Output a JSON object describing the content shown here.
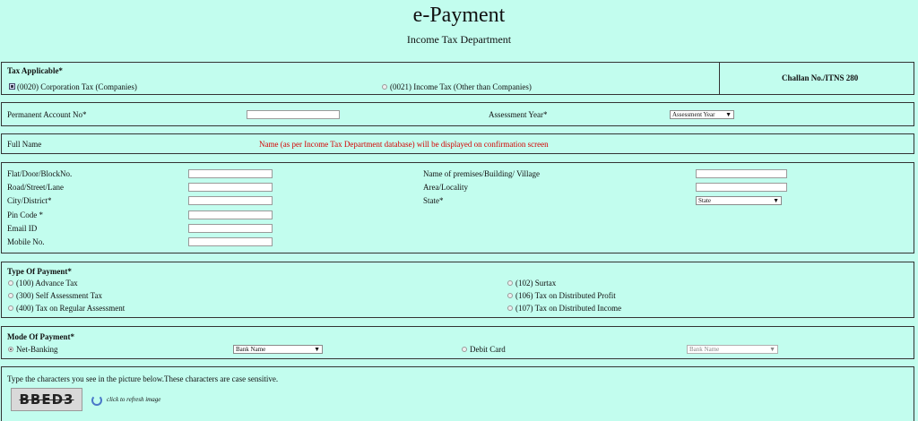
{
  "header": {
    "title": "e-Payment",
    "subtitle": "Income Tax Department"
  },
  "tax_applicable": {
    "label": "Tax Applicable*",
    "options": [
      {
        "label": "(0020) Corporation Tax (Companies)",
        "selected": true
      },
      {
        "label": "(0021) Income Tax (Other than Companies)",
        "selected": false
      }
    ],
    "challan": "Challan No./ITNS 280"
  },
  "pan": {
    "label": "Permanent Account No*",
    "value": "",
    "assessment_year_label": "Assessment Year*",
    "assessment_year_value": "Assessment Year"
  },
  "full_name": {
    "label": "Full Name",
    "note": "Name (as per Income Tax Department database) will be displayed on confirmation screen"
  },
  "address": {
    "flat": "Flat/Door/BlockNo.",
    "road": "Road/Street/Lane",
    "city": "City/District*",
    "pin": "Pin Code *",
    "email": "Email ID",
    "mobile": "Mobile No.",
    "premises": "Name of premises/Building/ Village",
    "area": "Area/Locality",
    "state": "State*",
    "state_value": "State"
  },
  "type_of_payment": {
    "label": "Type Of Payment*",
    "options": [
      "(100) Advance Tax",
      "(300) Self Assessment Tax",
      "(400) Tax on Regular Assessment",
      "(102) Surtax",
      "(106) Tax on Distributed Profit",
      "(107) Tax on Distributed Income"
    ]
  },
  "mode_of_payment": {
    "label": "Mode Of Payment*",
    "netbanking": "Net-Banking",
    "netbanking_selected": true,
    "bank_value": "Bank Name",
    "debit": "Debit Card",
    "debit_bank_value": "Bank Name"
  },
  "captcha": {
    "instruction": "Type the characters you see in the picture below.These characters are case sensitive.",
    "image_text": "BBED3",
    "refresh": "click to refresh image"
  },
  "colors": {
    "background": "#c2fdee",
    "note_red": "#d40000"
  }
}
